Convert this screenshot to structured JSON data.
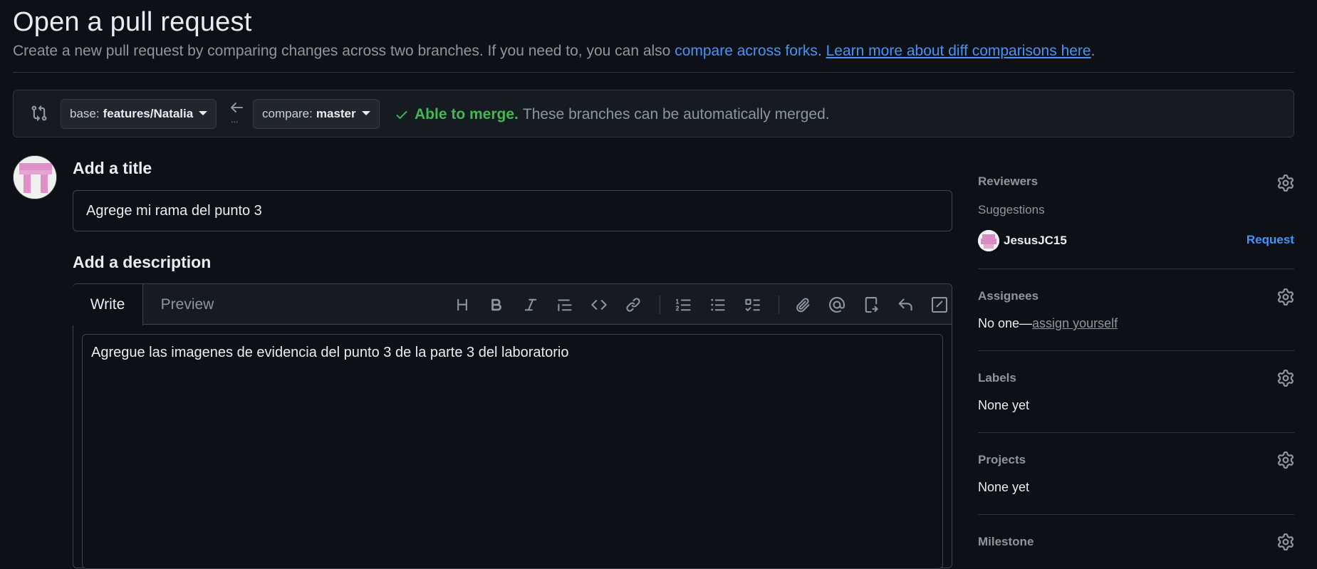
{
  "header": {
    "title": "Open a pull request",
    "subtitle_prefix": "Create a new pull request by comparing changes across two branches. If you need to, you can also ",
    "compare_forks_link": "compare across forks",
    "subtitle_mid": ". ",
    "learn_more_link": "Learn more about diff comparisons here",
    "subtitle_suffix": "."
  },
  "compare": {
    "base_key": "base:",
    "base_value": "features/Natalia",
    "compare_key": "compare:",
    "compare_value": "master",
    "merge_ok": "Able to merge.",
    "merge_rest": "These branches can be automatically merged.",
    "dots": "..."
  },
  "form": {
    "title_label": "Add a title",
    "title_value": "Agrege mi rama del punto 3",
    "description_label": "Add a description",
    "tab_write": "Write",
    "tab_preview": "Preview",
    "description_value": "Agregue las imagenes de evidencia del punto 3 de la parte 3 del laboratorio"
  },
  "sidebar": {
    "reviewers": {
      "title": "Reviewers",
      "suggestions": "Suggestions",
      "suggested_user": "JesusJC15",
      "request": "Request"
    },
    "assignees": {
      "title": "Assignees",
      "none_prefix": "No one—",
      "assign_yourself": "assign yourself"
    },
    "labels": {
      "title": "Labels",
      "value": "None yet"
    },
    "projects": {
      "title": "Projects",
      "value": "None yet"
    },
    "milestone": {
      "title": "Milestone"
    }
  },
  "colors": {
    "background": "#0d1117",
    "link": "#4493f8",
    "success": "#3fb950",
    "muted": "#8d96a0"
  },
  "icons": [
    "git-compare-icon",
    "arrow-left-icon",
    "check-icon",
    "heading-icon",
    "bold-icon",
    "italic-icon",
    "quote-icon",
    "code-icon",
    "link-icon",
    "ordered-list-icon",
    "unordered-list-icon",
    "task-list-icon",
    "paperclip-icon",
    "mention-icon",
    "cross-reference-icon",
    "reply-icon",
    "slash-command-icon",
    "gear-icon"
  ]
}
